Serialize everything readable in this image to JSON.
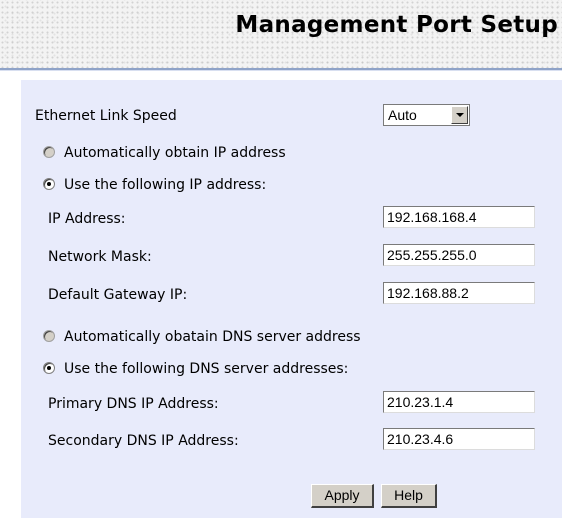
{
  "header": {
    "title": "Management Port Setup"
  },
  "form": {
    "link_speed": {
      "label": "Ethernet Link Speed",
      "selected": "Auto"
    },
    "ip_mode": {
      "auto_label": "Automatically obtain IP address",
      "manual_label": "Use the following IP address:",
      "selected": "manual"
    },
    "ip_address": {
      "label": "IP Address:",
      "value": "192.168.168.4"
    },
    "network_mask": {
      "label": "Network Mask:",
      "value": "255.255.255.0"
    },
    "gateway": {
      "label": "Default Gateway IP:",
      "value": "192.168.88.2"
    },
    "dns_mode": {
      "auto_label": "Automatically obatain DNS server address",
      "manual_label": "Use the following DNS server addresses:",
      "selected": "manual"
    },
    "primary_dns": {
      "label": "Primary DNS IP Address:",
      "value": "210.23.1.4"
    },
    "secondary_dns": {
      "label": "Secondary DNS IP Address:",
      "value": "210.23.4.6"
    }
  },
  "buttons": {
    "apply": "Apply",
    "help": "Help"
  },
  "colors": {
    "panel_bg": "#e8ebfb",
    "divider": "#8fa3c8"
  }
}
